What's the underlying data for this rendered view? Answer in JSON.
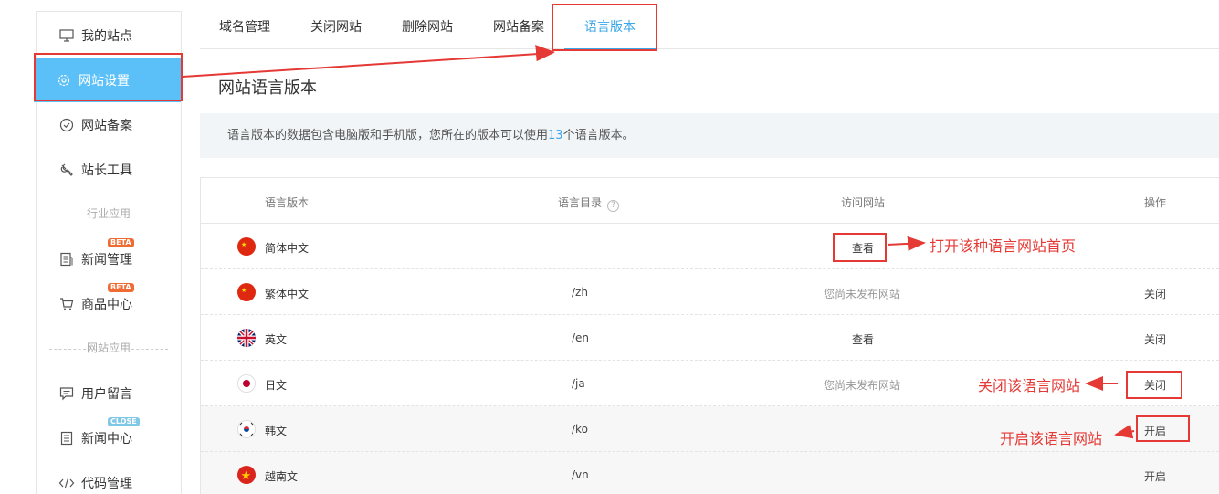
{
  "sidebar": {
    "items": [
      {
        "label": "我的站点",
        "icon": "monitor-icon"
      },
      {
        "label": "网站设置",
        "icon": "gear-icon"
      },
      {
        "label": "网站备案",
        "icon": "check-circle-icon"
      },
      {
        "label": "站长工具",
        "icon": "wrench-icon"
      }
    ],
    "section_industry": "行业应用",
    "industry_items": [
      {
        "label": "新闻管理",
        "icon": "document-icon",
        "badge": "BETA"
      },
      {
        "label": "商品中心",
        "icon": "cart-icon",
        "badge": "BETA"
      }
    ],
    "section_site": "网站应用",
    "site_items": [
      {
        "label": "用户留言",
        "icon": "message-icon"
      },
      {
        "label": "新闻中心",
        "icon": "document-icon",
        "badge": "CLOSE"
      },
      {
        "label": "代码管理",
        "icon": "code-icon"
      }
    ]
  },
  "tabs": [
    {
      "label": "域名管理"
    },
    {
      "label": "关闭网站"
    },
    {
      "label": "删除网站"
    },
    {
      "label": "网站备案"
    },
    {
      "label": "语言版本"
    }
  ],
  "page_title": "网站语言版本",
  "notice": {
    "prefix": "语言版本的数据包含电脑版和手机版，您所在的版本可以使用",
    "count": "13",
    "suffix": "个语言版本。"
  },
  "table": {
    "headers": {
      "lang": "语言版本",
      "dir": "语言目录",
      "help": "?",
      "visit": "访问网站",
      "op": "操作"
    },
    "rows": [
      {
        "lang": "简体中文",
        "flag": "cn",
        "dir": "",
        "visit": "查看",
        "op": ""
      },
      {
        "lang": "繁体中文",
        "flag": "cn",
        "dir": "/zh",
        "visit": "您尚未发布网站",
        "op": "关闭"
      },
      {
        "lang": "英文",
        "flag": "uk",
        "dir": "/en",
        "visit": "查看",
        "op": "关闭"
      },
      {
        "lang": "日文",
        "flag": "jp",
        "dir": "/ja",
        "visit": "您尚未发布网站",
        "op": "关闭"
      },
      {
        "lang": "韩文",
        "flag": "kr",
        "dir": "/ko",
        "visit": "",
        "op": "开启"
      },
      {
        "lang": "越南文",
        "flag": "vn",
        "dir": "/vn",
        "visit": "",
        "op": "开启"
      }
    ]
  },
  "annotations": {
    "open_home": "打开该种语言网站首页",
    "close_lang": "关闭该语言网站",
    "enable_lang": "开启该语言网站"
  },
  "colors": {
    "accent": "#39a7e8",
    "sidebar_active": "#5bc0f8",
    "annotation": "#e53935"
  }
}
